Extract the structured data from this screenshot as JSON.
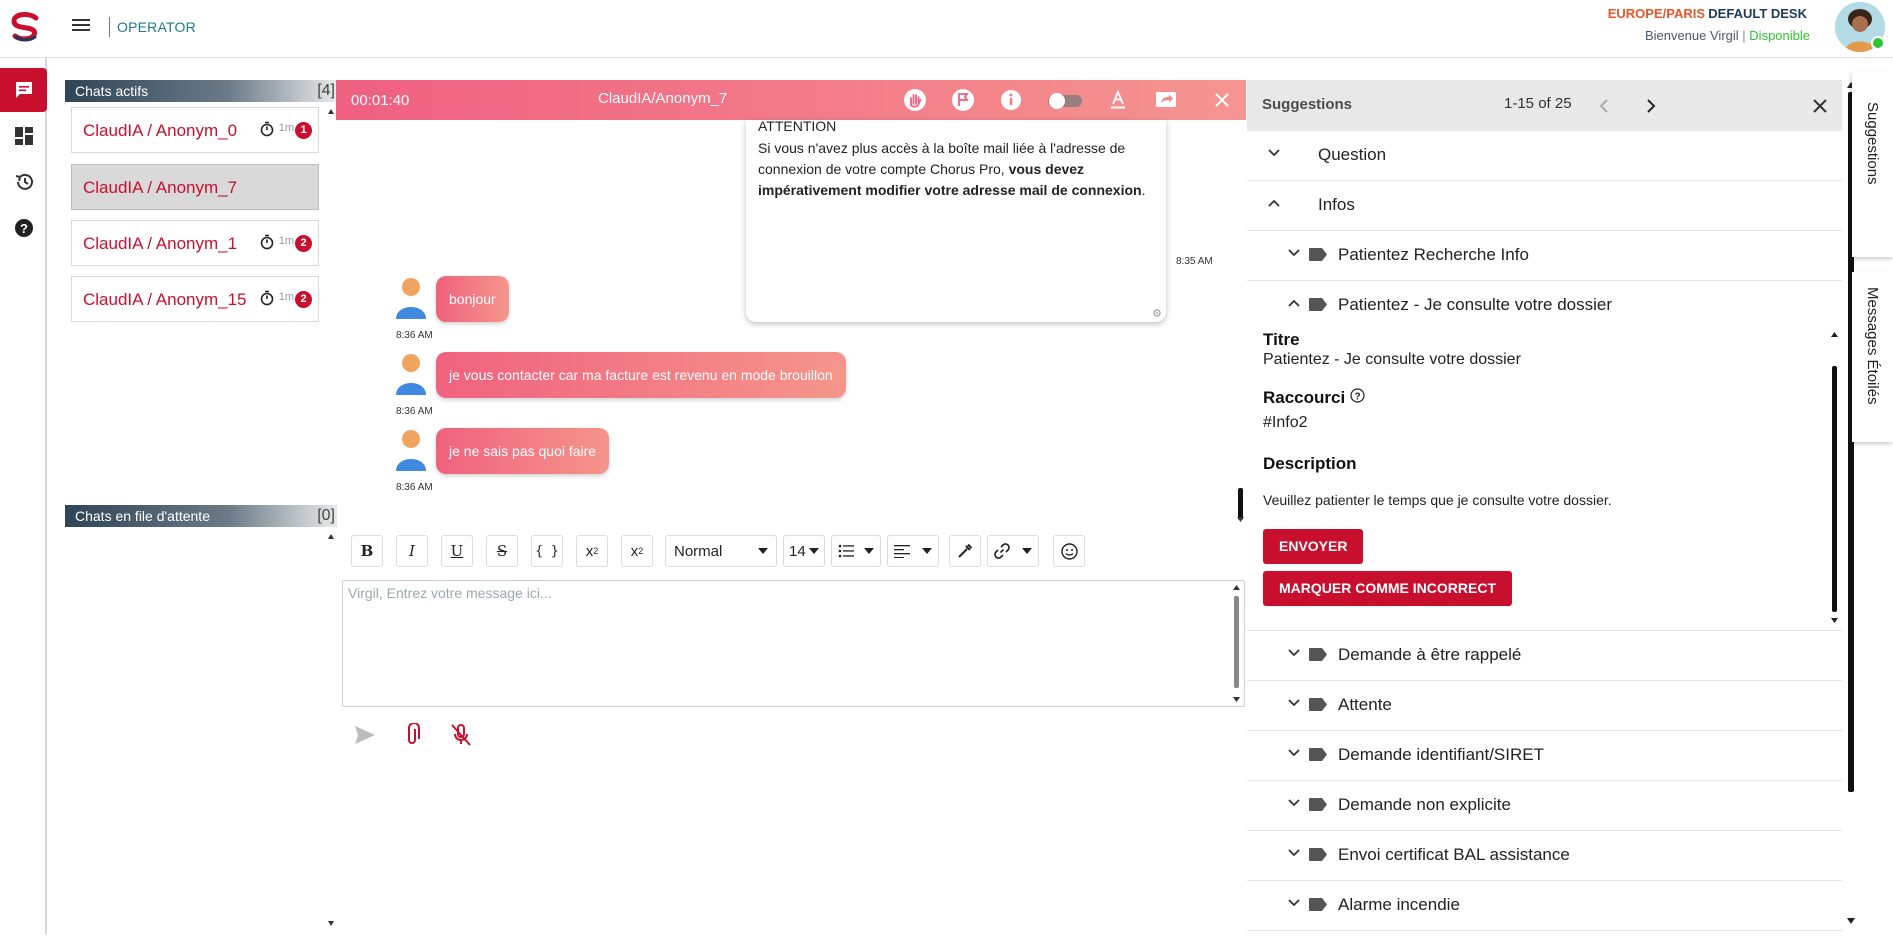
{
  "header": {
    "app_title": "OPERATOR",
    "timezone": "EUROPE/PARIS",
    "desk": "DEFAULT DESK",
    "welcome": "Bienvenue Virgil",
    "status": "Disponible"
  },
  "active_chats": {
    "title": "Chats actifs",
    "count": "[4]",
    "items": [
      {
        "label": "ClaudIA / Anonym_0",
        "mins": "1m",
        "badge": "1"
      },
      {
        "label": "ClaudIA / Anonym_7",
        "mins": "",
        "badge": ""
      },
      {
        "label": "ClaudIA / Anonym_1",
        "mins": "1m",
        "badge": "2"
      },
      {
        "label": "ClaudIA / Anonym_15",
        "mins": "1m",
        "badge": "2"
      }
    ]
  },
  "queue": {
    "title": "Chats en file d'attente",
    "count": "[0]"
  },
  "conversation": {
    "timer": "00:01:40",
    "title": "ClaudIA/Anonym_7",
    "notice": {
      "heading": "ATTENTION",
      "text_1": " Si vous n'avez plus accès à la boîte mail liée à l'adresse de connexion de votre compte Chorus Pro, ",
      "text_bold": "vous devez impérativement modifier votre adresse mail de connexion",
      "text_2": ".",
      "time": "8:35 AM"
    },
    "messages": [
      {
        "text": "bonjour",
        "time": "8:36 AM"
      },
      {
        "text": "je vous contacter car ma facture est revenu en mode brouillon",
        "time": "8:36 AM"
      },
      {
        "text": "je ne sais pas quoi faire",
        "time": "8:36 AM"
      }
    ]
  },
  "editor": {
    "font_style": "Normal",
    "font_size": "14",
    "placeholder": "Virgil, Entrez votre message ici..."
  },
  "suggestions": {
    "title": "Suggestions",
    "pager": "1-15 of 25",
    "categories": [
      {
        "label": "Question"
      },
      {
        "label": "Infos"
      }
    ],
    "items": [
      {
        "label": "Patientez Recherche Info"
      },
      {
        "label": "Patientez - Je consulte votre dossier"
      },
      {
        "label": "Demande à être rappelé"
      },
      {
        "label": "Attente"
      },
      {
        "label": "Demande identifiant/SIRET"
      },
      {
        "label": "Demande non explicite"
      },
      {
        "label": "Envoi certificat BAL assistance"
      },
      {
        "label": "Alarme incendie"
      }
    ],
    "detail": {
      "title_label": "Titre",
      "title_value": "Patientez - Je consulte votre dossier",
      "shortcut_label": "Raccourci",
      "shortcut_value": "#Info2",
      "description_label": "Description",
      "description_value": "Veuillez patienter le temps que je consulte votre dossier.",
      "send_button": "ENVOYER",
      "incorrect_button": "MARQUER COMME INCORRECT"
    }
  },
  "side_tabs": {
    "suggestions": "Suggestions",
    "starred": "Messages Étoilés"
  },
  "colors": {
    "brand_red": "#c8102e",
    "accent_orange": "#e8562a",
    "available_green": "#2ec52e"
  }
}
